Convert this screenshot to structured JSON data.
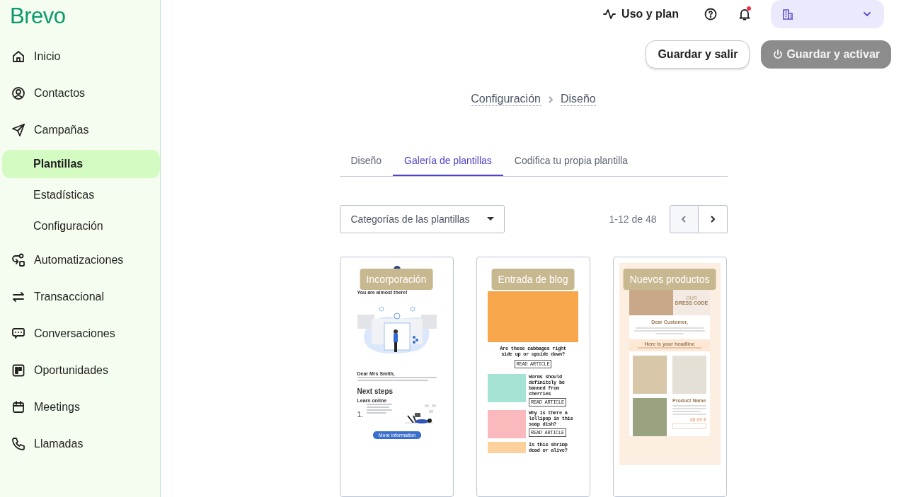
{
  "sidebar": {
    "logo": "Brevo",
    "items": [
      {
        "label": "Inicio",
        "selected": false
      },
      {
        "label": "Contactos",
        "selected": false
      },
      {
        "label": "Campañas",
        "selected": false,
        "children": [
          {
            "label": "Plantillas",
            "selected": true
          },
          {
            "label": "Estadísticas",
            "selected": false
          },
          {
            "label": "Configuración",
            "selected": false
          }
        ]
      },
      {
        "label": "Automatizaciones",
        "selected": false
      },
      {
        "label": "Transaccional",
        "selected": false
      },
      {
        "label": "Conversaciones",
        "selected": false
      },
      {
        "label": "Oportunidades",
        "selected": false
      },
      {
        "label": "Meetings",
        "selected": false
      },
      {
        "label": "Llamadas",
        "selected": false
      }
    ]
  },
  "top_bar": {
    "usage_link": "Uso y plan",
    "notifications_unread": true
  },
  "actions": [
    {
      "label": "Guardar y salir",
      "kind": "secondary",
      "disabled": false
    },
    {
      "label": "Guardar y activar",
      "kind": "primary",
      "disabled": true
    }
  ],
  "breadcrumb": [
    "Configuración",
    "Diseño"
  ],
  "tabs": [
    {
      "label": "Diseño",
      "selected": false
    },
    {
      "label": "Galería de plantillas",
      "selected": true
    },
    {
      "label": "Codifica tu propia plantilla",
      "selected": false
    }
  ],
  "category_filter": {
    "label": "Categorías de las plantillas"
  },
  "pagination": {
    "range": "1-12 de 48",
    "prev_disabled": true,
    "next_disabled": false
  },
  "templates": [
    {
      "tag": "Incorporación",
      "kind": "onboarding",
      "texts": [
        "You are almost there!",
        "Dear Mrs Smith,",
        "Next steps",
        "Learn online",
        "1.",
        "More information"
      ]
    },
    {
      "tag": "Entrada de blog",
      "kind": "blog",
      "texts": [
        "Are these cabbages right side up or upside down?",
        "READ ARTICLE",
        "Worms should definitely be banned from cherries",
        "READ ARTICLE",
        "Why is there a lollipop in this soap dish?",
        "READ ARTICLE",
        "Is this shrimp dead or alive?"
      ]
    },
    {
      "tag": "Nuevos productos",
      "kind": "products",
      "texts": [
        "OUR",
        "DRESS CODE",
        "Dear Customer,",
        "Here is your headline",
        "Product Name",
        "48,99 €"
      ]
    }
  ]
}
